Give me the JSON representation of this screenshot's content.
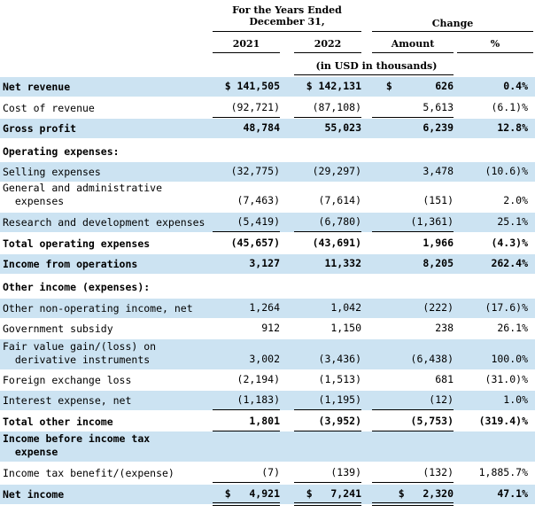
{
  "header": {
    "period_line1": "For the Years Ended",
    "period_line2": "December 31,",
    "change": "Change",
    "col_2021": "2021",
    "col_2022": "2022",
    "col_amount": "Amount",
    "col_pct": "%",
    "units": "(in USD in thousands)"
  },
  "rows": [
    {
      "label": "Net revenue",
      "c1": "$ 141,505",
      "c2": "$ 142,131",
      "c3": "$       626",
      "c4": "0.4%",
      "bold": true,
      "shade": true
    },
    {
      "label": "Cost of revenue",
      "c1": "(92,721)",
      "c2": "(87,108)",
      "c3": "5,613",
      "c4": "(6.1)%",
      "bold": false,
      "shade": false
    },
    {
      "label": "Gross profit",
      "c1": "48,784",
      "c2": "55,023",
      "c3": "6,239",
      "c4": "12.8%",
      "bold": true,
      "shade": true
    },
    {
      "label": "Operating expenses:",
      "c1": "",
      "c2": "",
      "c3": "",
      "c4": "",
      "bold": true,
      "shade": false
    },
    {
      "label": "Selling expenses",
      "c1": "(32,775)",
      "c2": "(29,297)",
      "c3": "3,478",
      "c4": "(10.6)%",
      "bold": false,
      "shade": true
    },
    {
      "label": "General and administrative\n  expenses",
      "c1": "(7,463)",
      "c2": "(7,614)",
      "c3": "(151)",
      "c4": "2.0%",
      "bold": false,
      "shade": false
    },
    {
      "label": "Research and development expenses",
      "c1": "(5,419)",
      "c2": "(6,780)",
      "c3": "(1,361)",
      "c4": "25.1%",
      "bold": false,
      "shade": true
    },
    {
      "label": "Total operating expenses",
      "c1": "(45,657)",
      "c2": "(43,691)",
      "c3": "1,966",
      "c4": "(4.3)%",
      "bold": true,
      "shade": false
    },
    {
      "label": "Income from operations",
      "c1": "3,127",
      "c2": "11,332",
      "c3": "8,205",
      "c4": "262.4%",
      "bold": true,
      "shade": true
    },
    {
      "label": "Other income (expenses):",
      "c1": "",
      "c2": "",
      "c3": "",
      "c4": "",
      "bold": true,
      "shade": false
    },
    {
      "label": "Other non-operating income, net",
      "c1": "1,264",
      "c2": "1,042",
      "c3": "(222)",
      "c4": "(17.6)%",
      "bold": false,
      "shade": true
    },
    {
      "label": "Government subsidy",
      "c1": "912",
      "c2": "1,150",
      "c3": "238",
      "c4": "26.1%",
      "bold": false,
      "shade": false
    },
    {
      "label": "Fair value gain/(loss) on\n  derivative instruments",
      "c1": "3,002",
      "c2": "(3,436)",
      "c3": "(6,438)",
      "c4": "100.0%",
      "bold": false,
      "shade": true
    },
    {
      "label": "Foreign exchange loss",
      "c1": "(2,194)",
      "c2": "(1,513)",
      "c3": "681",
      "c4": "(31.0)%",
      "bold": false,
      "shade": false
    },
    {
      "label": "Interest expense, net",
      "c1": "(1,183)",
      "c2": "(1,195)",
      "c3": "(12)",
      "c4": "1.0%",
      "bold": false,
      "shade": true
    },
    {
      "label": "Total other income",
      "c1": "1,801",
      "c2": "(3,952)",
      "c3": "(5,753)",
      "c4": "(319.4)%",
      "bold": true,
      "shade": false
    },
    {
      "label": "Income before income tax\n  expense",
      "c1": "",
      "c2": "",
      "c3": "",
      "c4": "",
      "bold": true,
      "shade": true
    },
    {
      "label": "Income tax benefit/(expense)",
      "c1": "(7)",
      "c2": "(139)",
      "c3": "(132)",
      "c4": "1,885.7%",
      "bold": false,
      "shade": false
    },
    {
      "label": "Net income",
      "c1": "$   4,921",
      "c2": "$   7,241",
      "c3": "$   2,320",
      "c4": "47.1%",
      "bold": true,
      "shade": true
    }
  ]
}
